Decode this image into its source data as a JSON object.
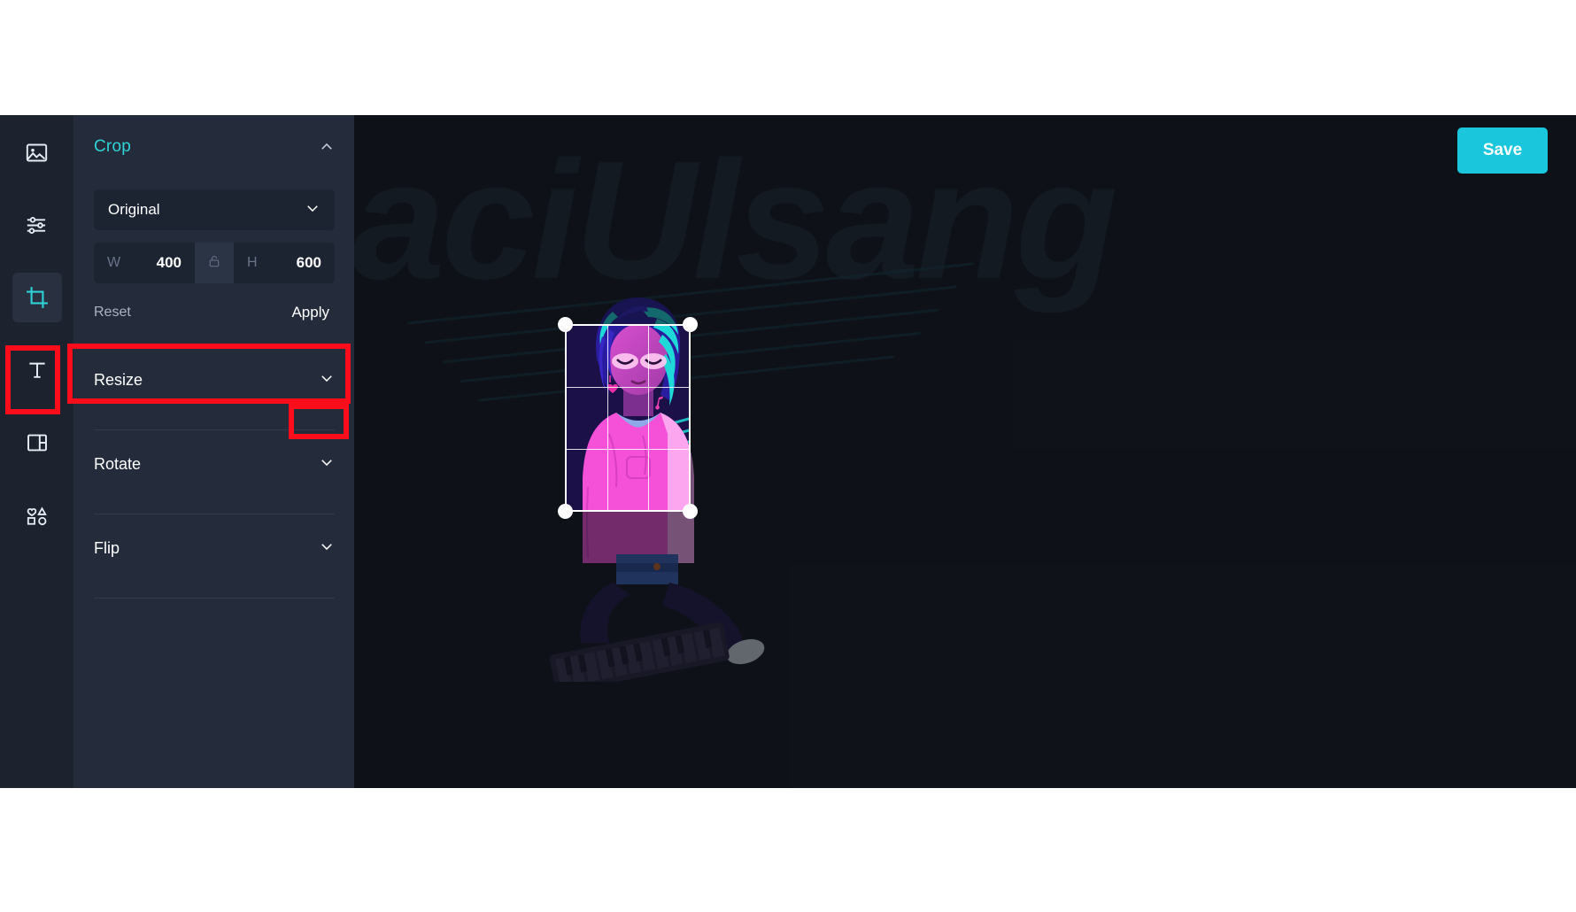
{
  "app": {
    "accent_teal": "#2ed3d8",
    "save_button_color": "#19c6dc",
    "annotation_color": "#fc0d1b",
    "panel_bg": "#242c3b",
    "canvas_bg": "#141821"
  },
  "rail": {
    "items": [
      {
        "icon": "image-icon",
        "name": "image",
        "active": false
      },
      {
        "icon": "adjustments-icon",
        "name": "adjust",
        "active": false
      },
      {
        "icon": "crop-icon",
        "name": "crop",
        "active": true
      },
      {
        "icon": "text-icon",
        "name": "text",
        "active": false
      },
      {
        "icon": "frame-icon",
        "name": "frame",
        "active": false
      },
      {
        "icon": "shapes-icon",
        "name": "shapes",
        "active": false
      }
    ]
  },
  "panel": {
    "title": "Crop",
    "collapse_icon": "chevron-up-icon",
    "ratio_select": {
      "value": "Original",
      "chevron": "chevron-down-icon"
    },
    "dimensions": {
      "width_label": "W",
      "width_value": "400",
      "lock_icon": "lock-icon",
      "height_label": "H",
      "height_value": "600"
    },
    "reset_label": "Reset",
    "apply_label": "Apply",
    "sections": [
      {
        "label": "Resize",
        "chevron": "chevron-down-icon"
      },
      {
        "label": "Rotate",
        "chevron": "chevron-down-icon"
      },
      {
        "label": "Flip",
        "chevron": "chevron-down-icon"
      }
    ]
  },
  "toolbar": {
    "save_label": "Save"
  },
  "canvas": {
    "watermark_text": "LaciUlsang",
    "crop_selection": {
      "handles": [
        "top-left",
        "top-right",
        "bottom-left",
        "bottom-right"
      ],
      "grid": "rule-of-thirds"
    }
  }
}
